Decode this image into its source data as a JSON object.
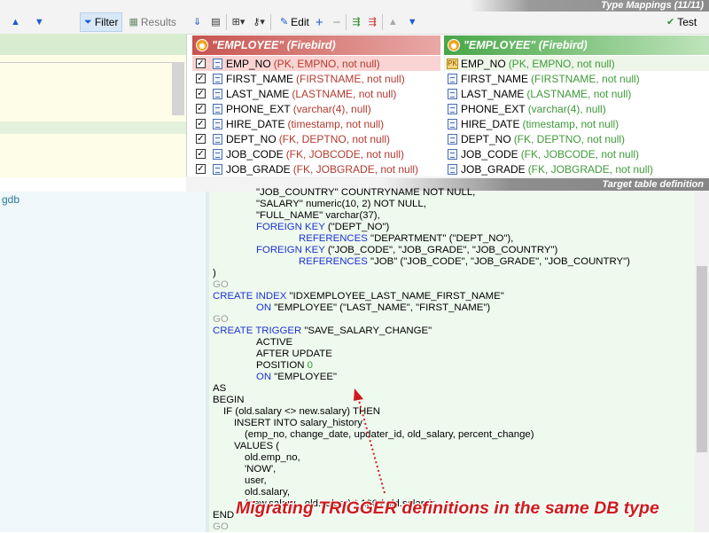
{
  "toolbar": {
    "filter_label": "Filter",
    "results_label": "Results",
    "edit_label": "Edit",
    "test_label": "Test"
  },
  "type_mappings_label": "Type Mappings (11/11)",
  "target_table_label": "Target table definition",
  "left_lower_text": "gdb",
  "source_table": {
    "title": "\"EMPLOYEE\"  (Firebird)",
    "rows": [
      {
        "name": "EMP_NO",
        "attrs": "(PK, EMPNO, not null)"
      },
      {
        "name": "FIRST_NAME",
        "attrs": "(FIRSTNAME, not null)"
      },
      {
        "name": "LAST_NAME",
        "attrs": "(LASTNAME, not null)"
      },
      {
        "name": "PHONE_EXT",
        "attrs": "(varchar(4), null)"
      },
      {
        "name": "HIRE_DATE",
        "attrs": "(timestamp, not null)"
      },
      {
        "name": "DEPT_NO",
        "attrs": "(FK, DEPTNO, not null)"
      },
      {
        "name": "JOB_CODE",
        "attrs": "(FK, JOBCODE, not null)"
      },
      {
        "name": "JOB_GRADE",
        "attrs": "(FK, JOBGRADE, not null)"
      }
    ]
  },
  "target_table": {
    "title": "\"EMPLOYEE\"  (Firebird)",
    "rows": [
      {
        "name": "EMP_NO",
        "attrs": "(PK, EMPNO, not null)"
      },
      {
        "name": "FIRST_NAME",
        "attrs": "(FIRSTNAME, not null)"
      },
      {
        "name": "LAST_NAME",
        "attrs": "(LASTNAME, not null)"
      },
      {
        "name": "PHONE_EXT",
        "attrs": "(varchar(4), null)"
      },
      {
        "name": "HIRE_DATE",
        "attrs": "(timestamp, not null)"
      },
      {
        "name": "DEPT_NO",
        "attrs": "(FK, DEPTNO, not null)"
      },
      {
        "name": "JOB_CODE",
        "attrs": "(FK, JOBCODE, not null)"
      },
      {
        "name": "JOB_GRADE",
        "attrs": "(FK, JOBGRADE, not null)"
      }
    ]
  },
  "code": {
    "l0": "\"JOB_COUNTRY\" COUNTRYNAME NOT NULL,",
    "l1": "\"SALARY\" numeric(10, 2) NOT NULL,",
    "l2": "\"FULL_NAME\" varchar(37),",
    "l3a": "FOREIGN KEY",
    "l3b": " (\"DEPT_NO\")",
    "l4a": "REFERENCES",
    "l4b": " \"DEPARTMENT\" (\"DEPT_NO\"),",
    "l5a": "FOREIGN KEY",
    "l5b": " (\"JOB_CODE\", \"JOB_GRADE\", \"JOB_COUNTRY\")",
    "l6a": "REFERENCES",
    "l6b": " \"JOB\" (\"JOB_CODE\", \"JOB_GRADE\", \"JOB_COUNTRY\")",
    "l7": ")",
    "go": "GO",
    "l9a": "CREATE INDEX",
    "l9b": " \"IDXEMPLOYEE_LAST_NAME_FIRST_NAME\"",
    "l10a": "ON",
    "l10b": " \"EMPLOYEE\" (\"LAST_NAME\", \"FIRST_NAME\")",
    "l12a": "CREATE TRIGGER",
    "l12b": " \"SAVE_SALARY_CHANGE\"",
    "l13": "ACTIVE",
    "l14": "AFTER UPDATE",
    "l15a": "POSITION",
    "l15b": "0",
    "l16a": "ON",
    "l16b": " \"EMPLOYEE\"",
    "l17": "AS",
    "l18": "BEGIN",
    "l19": "IF (old.salary <> new.salary) THEN",
    "l20": "INSERT INTO salary_history",
    "l21": "(emp_no, change_date, updater_id, old_salary, percent_change)",
    "l22": "VALUES (",
    "l23": "old.emp_no,",
    "l24": "'NOW',",
    "l25": "user,",
    "l26": "old.salary,",
    "l27": "(new.salary - old.salary) * 100 / old.salary);",
    "l28": "END"
  },
  "caption": "Migrating TRIGGER definitions in the same DB type"
}
